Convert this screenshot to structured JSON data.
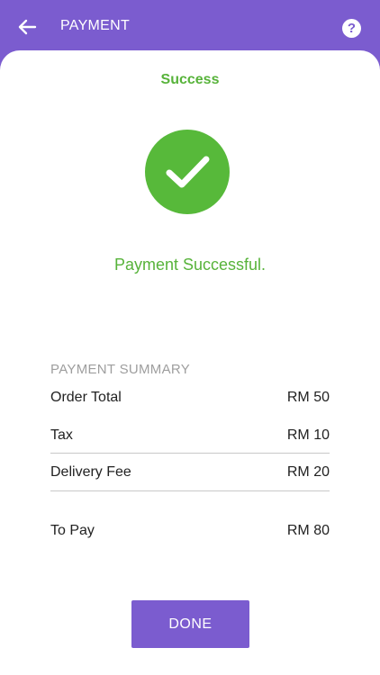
{
  "header": {
    "title": "PAYMENT",
    "back_icon": "arrow-left-icon",
    "help_icon": "question-icon",
    "help_glyph": "?"
  },
  "status": {
    "label": "Success",
    "icon": "checkmark-icon",
    "message": "Payment Successful."
  },
  "summary": {
    "heading": "PAYMENT SUMMARY",
    "items": [
      {
        "label": "Order Total",
        "value": "RM 50"
      },
      {
        "label": "Tax",
        "value": "RM 10"
      },
      {
        "label": "Delivery Fee",
        "value": "RM 20"
      }
    ],
    "total": {
      "label": "To Pay",
      "value": "RM 80"
    }
  },
  "actions": {
    "done_label": "DONE"
  },
  "colors": {
    "brand": "#7b5ccf",
    "success": "#57b93a",
    "muted": "#9e9e9e"
  }
}
